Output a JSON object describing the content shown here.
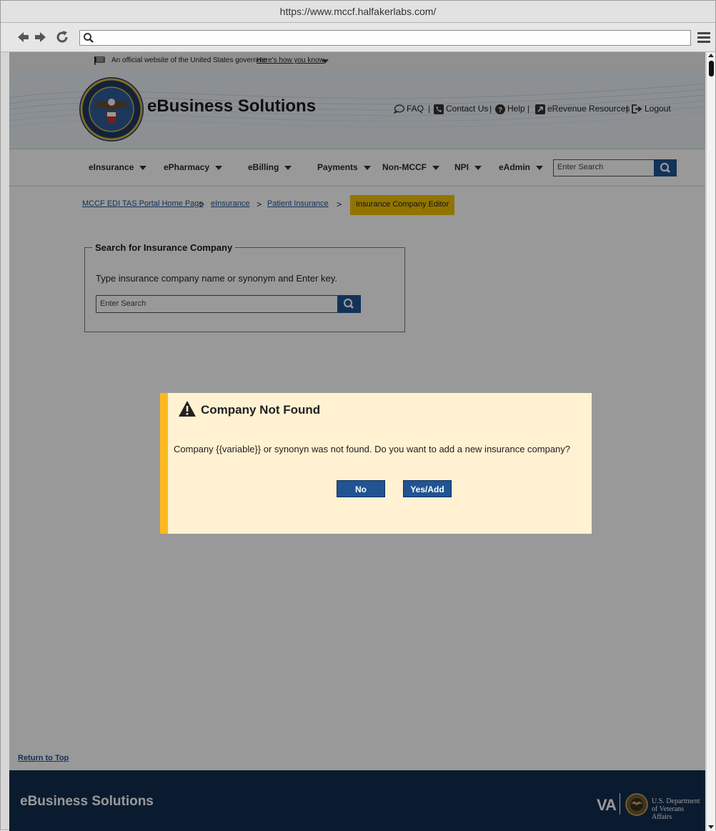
{
  "browser": {
    "url": "https://www.mccf.halfakerlabs.com/"
  },
  "banner": {
    "official_text": "An official website of the United States governme",
    "how_link": "Here's how you know"
  },
  "header": {
    "brand": "eBusiness Solutions",
    "utility_links": [
      {
        "label": "FAQ",
        "icon": "chat-bubble-icon"
      },
      {
        "label": "Contact Us",
        "icon": "phone-icon"
      },
      {
        "label": "Help",
        "icon": "question-icon"
      },
      {
        "label": "eRevenue Resources",
        "icon": "external-link-icon"
      },
      {
        "label": "Logout",
        "icon": "logout-icon"
      }
    ],
    "separator": "|"
  },
  "nav": {
    "items": [
      "eInsurance",
      "ePharmacy",
      "eBilling",
      "Payments",
      "Non-MCCF",
      "NPI",
      "eAdmin"
    ],
    "search_placeholder": "Enter Search"
  },
  "breadcrumb": {
    "items": [
      "MCCF EDI TAS Portal Home Page",
      "eInsurance",
      "Patient Insurance"
    ],
    "arrow": ">",
    "current": "Insurance Company Editor"
  },
  "search_panel": {
    "legend": "Search for Insurance Company",
    "hint": "Type insurance company name or synonym and Enter key.",
    "placeholder": "Enter Search"
  },
  "dialog": {
    "title": "Company Not Found",
    "message": "Company {{variable}} or synonyn was not found. Do you want to add a new insurance company?",
    "no_label": "No",
    "yes_label": "Yes/Add"
  },
  "return_to_top": "Return to Top",
  "footer": {
    "brand": "eBusiness Solutions",
    "va_mark": "VA",
    "dept_line1": "U.S. Department",
    "dept_line2": "of Veterans Affairs"
  },
  "colors": {
    "primary_blue": "#205493",
    "footer_navy": "#112e51",
    "warning_gold": "#fdb81e",
    "breadcrumb_gold": "#f4c400"
  }
}
